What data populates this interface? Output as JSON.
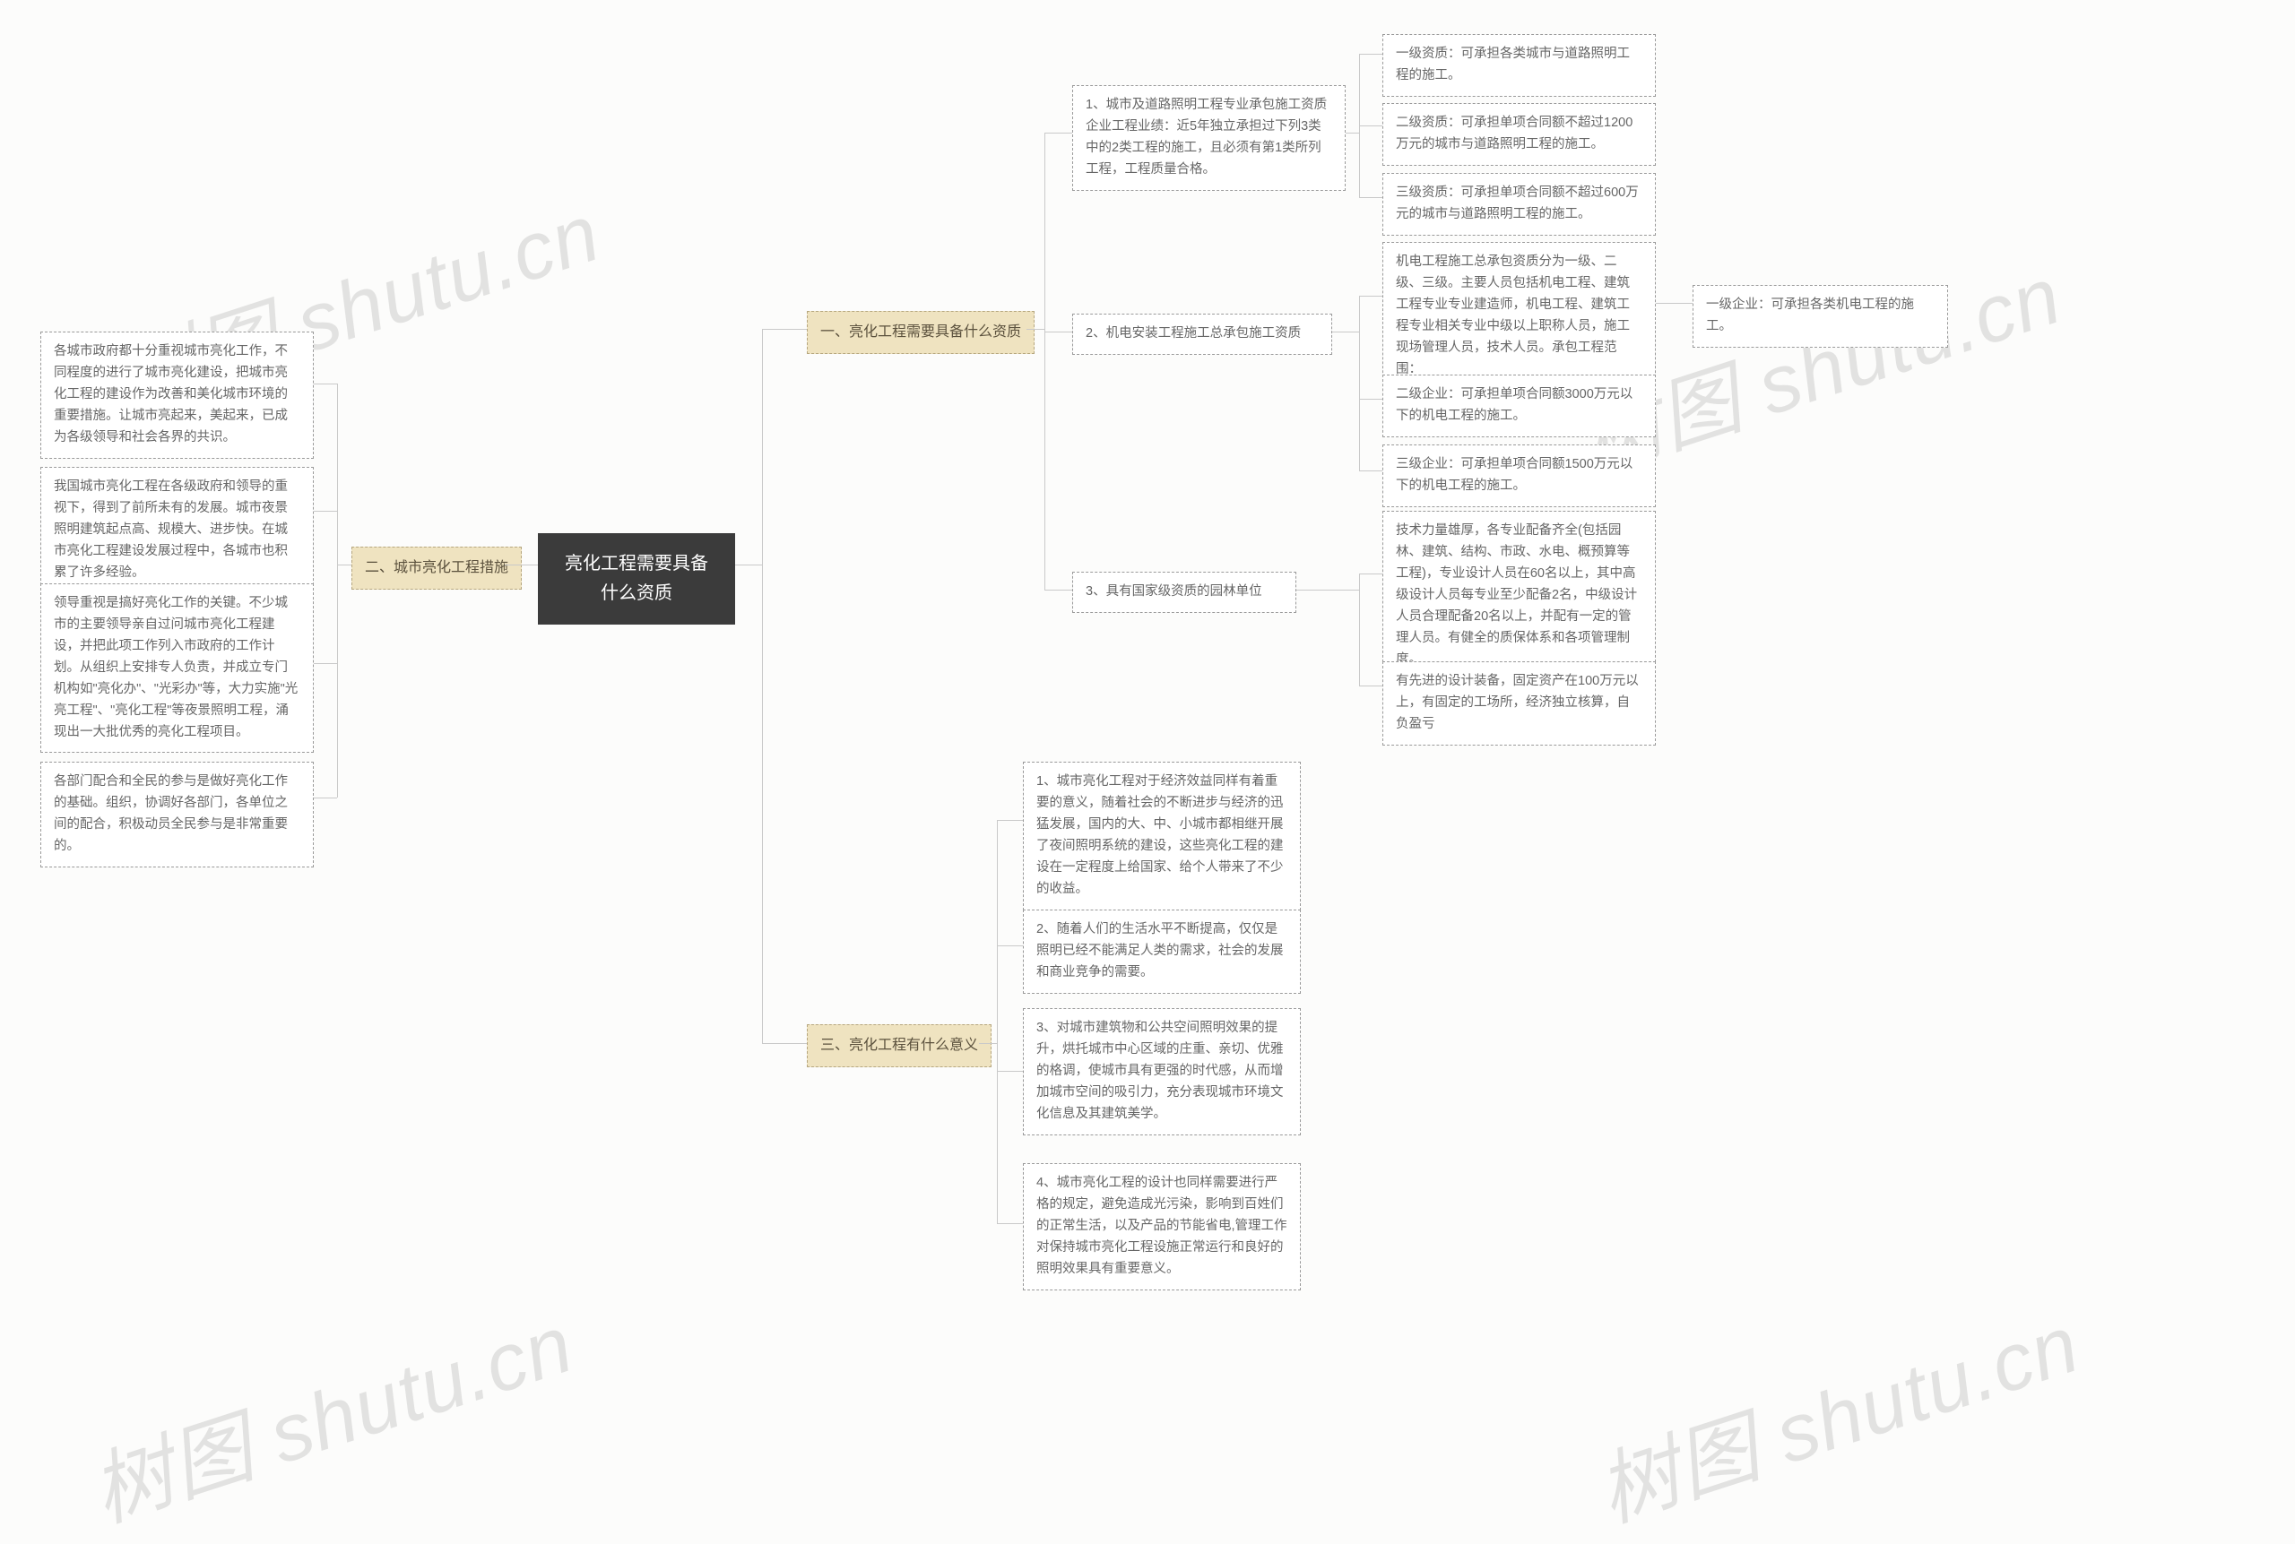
{
  "root": "亮化工程需要具备什么资质",
  "branches": {
    "b1": "一、亮化工程需要具备什么资质",
    "b2": "二、城市亮化工程措施",
    "b3": "三、亮化工程有什么意义"
  },
  "b1": {
    "n1": "1、城市及道路照明工程专业承包施工资质企业工程业绩：近5年独立承担过下列3类中的2类工程的施工，且必须有第1类所列工程，工程质量合格。",
    "n1_c1": "一级资质：可承担各类城市与道路照明工程的施工。",
    "n1_c2": "二级资质：可承担单项合同额不超过1200万元的城市与道路照明工程的施工。",
    "n1_c3": "三级资质：可承担单项合同额不超过600万元的城市与道路照明工程的施工。",
    "n2": "2、机电安装工程施工总承包施工资质",
    "n2_c1": "机电工程施工总承包资质分为一级、二级、三级。主要人员包括机电工程、建筑工程专业专业建造师，机电工程、建筑工程专业相关专业中级以上职称人员，施工现场管理人员，技术人员。承包工程范围：",
    "n2_c1_c1": "一级企业：可承担各类机电工程的施工。",
    "n2_c2": "二级企业：可承担单项合同额3000万元以下的机电工程的施工。",
    "n2_c3": "三级企业：可承担单项合同额1500万元以下的机电工程的施工。",
    "n3": "3、具有国家级资质的园林单位",
    "n3_c1": "技术力量雄厚，各专业配备齐全(包括园林、建筑、结构、市政、水电、概预算等工程)，专业设计人员在60名以上，其中高级设计人员每专业至少配备2名，中级设计人员合理配备20名以上，并配有一定的管理人员。有健全的质保体系和各项管理制度。",
    "n3_c2": "有先进的设计装备，固定资产在100万元以上，有固定的工场所，经济独立核算，自负盈亏"
  },
  "b2": {
    "n1": "各城市政府都十分重视城市亮化工作，不同程度的进行了城市亮化建设，把城市亮化工程的建设作为改善和美化城市环境的重要措施。让城市亮起来，美起来，已成为各级领导和社会各界的共识。",
    "n2": "我国城市亮化工程在各级政府和领导的重视下，得到了前所未有的发展。城市夜景照明建筑起点高、规模大、进步快。在城市亮化工程建设发展过程中，各城市也积累了许多经验。",
    "n3": "领导重视是搞好亮化工作的关键。不少城市的主要领导亲自过问城市亮化工程建设，并把此项工作列入市政府的工作计划。从组织上安排专人负责，并成立专门机构如\"亮化办\"、\"光彩办\"等，大力实施\"光亮工程\"、\"亮化工程\"等夜景照明工程，涌现出一大批优秀的亮化工程项目。",
    "n4": "各部门配合和全民的参与是做好亮化工作的基础。组织，协调好各部门，各单位之间的配合，积极动员全民参与是非常重要的。"
  },
  "b3": {
    "n1": "1、城市亮化工程对于经济效益同样有着重要的意义，随着社会的不断进步与经济的迅猛发展，国内的大、中、小城市都相继开展了夜间照明系统的建设，这些亮化工程的建设在一定程度上给国家、给个人带来了不少的收益。",
    "n2": "2、随着人们的生活水平不断提高，仅仅是照明已经不能满足人类的需求，社会的发展和商业竞争的需要。",
    "n3": "3、对城市建筑物和公共空间照明效果的提升，烘托城市中心区域的庄重、亲切、优雅的格调，使城市具有更强的时代感，从而增加城市空间的吸引力，充分表现城市环境文化信息及其建筑美学。",
    "n4": "4、城市亮化工程的设计也同样需要进行严格的规定，避免造成光污染，影响到百姓们的正常生活，以及产品的节能省电,管理工作对保持城市亮化工程设施正常运行和良好的照明效果具有重要意义。"
  },
  "watermarks": {
    "w1": "树图 shutu.cn",
    "w2": "树图 shutu.cn",
    "w3": "树图 shutu.cn",
    "w4": "树图 shutu.cn"
  }
}
